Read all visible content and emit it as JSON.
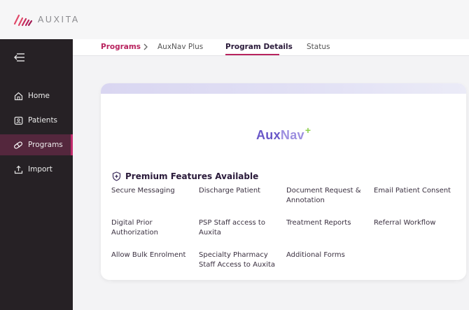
{
  "app": {
    "logo_text": "AUXITA"
  },
  "sidebar": {
    "collapse_icon": "collapse-menu-icon",
    "items": [
      {
        "label": "Home",
        "icon": "home-icon",
        "active": false
      },
      {
        "label": "Patients",
        "icon": "patients-icon",
        "active": false
      },
      {
        "label": "Programs",
        "icon": "programs-icon",
        "active": true
      },
      {
        "label": "Import",
        "icon": "import-icon",
        "active": false
      }
    ]
  },
  "breadcrumb": {
    "root": "Programs",
    "current": "AuxNav Plus"
  },
  "tabs": [
    {
      "label": "Program Details",
      "active": true
    },
    {
      "label": "Status",
      "active": false
    }
  ],
  "card": {
    "brand_main": "Aux",
    "brand_accent": "Nav",
    "brand_plus": "+",
    "features_title": "Premium Features Available",
    "features": [
      "Secure Messaging",
      "Discharge Patient",
      "Document Request & Annotation",
      "Email Patient Consent",
      "Digital Prior Authorization",
      "PSP Staff access to Auxita",
      "Treatment Reports",
      "Referral Workflow",
      "Allow Bulk Enrolment",
      "Specialty Pharmacy Staff Access to Auxita",
      "Additional Forms"
    ]
  },
  "colors": {
    "accent": "#b8235e",
    "sidebar_bg": "#262125",
    "active_nav_bg": "#54273d",
    "brand_purple": "#6a58c8",
    "brand_green": "#8fd14f"
  }
}
